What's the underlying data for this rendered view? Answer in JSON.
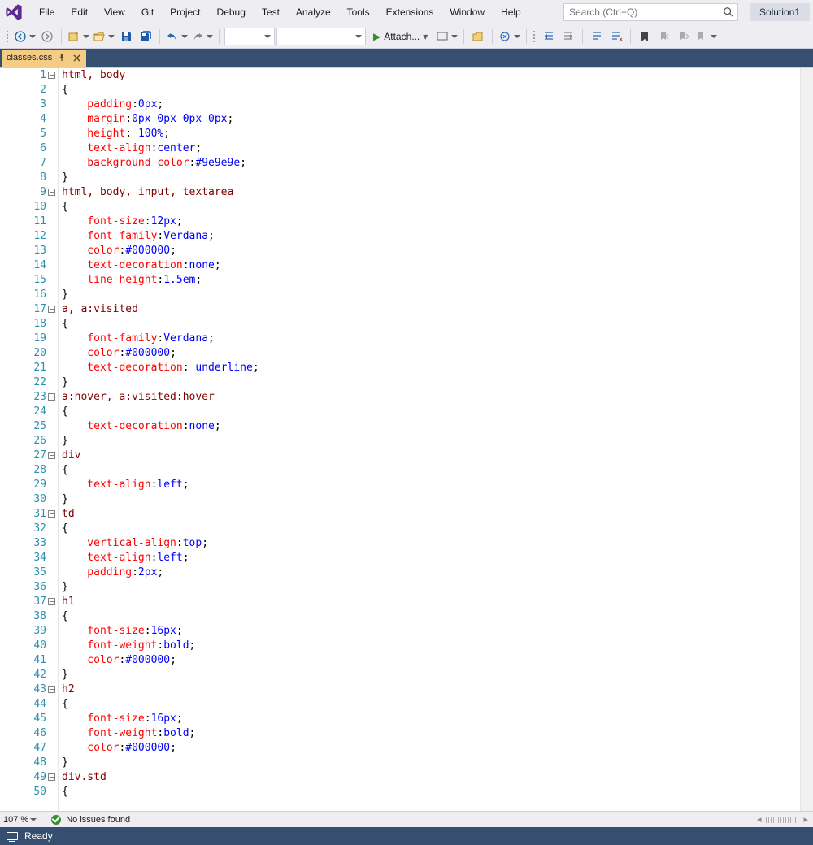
{
  "menu": [
    "File",
    "Edit",
    "View",
    "Git",
    "Project",
    "Debug",
    "Test",
    "Analyze",
    "Tools",
    "Extensions",
    "Window",
    "Help"
  ],
  "search_placeholder": "Search (Ctrl+Q)",
  "solution_name": "Solution1",
  "attach_label": "Attach...",
  "tab_title": "classes.css",
  "zoom": "107 %",
  "issues": "No issues found",
  "status": "Ready",
  "code_lines": [
    {
      "n": 1,
      "fold": true,
      "t": [
        [
          "sel",
          "html, body"
        ]
      ]
    },
    {
      "n": 2,
      "t": [
        [
          "punct",
          "{"
        ]
      ]
    },
    {
      "n": 3,
      "t": [
        [
          "prop",
          "    padding"
        ],
        [
          "punct",
          ":"
        ],
        [
          "val",
          "0px"
        ],
        [
          "punct",
          ";"
        ]
      ]
    },
    {
      "n": 4,
      "t": [
        [
          "prop",
          "    margin"
        ],
        [
          "punct",
          ":"
        ],
        [
          "val",
          "0px 0px 0px 0px"
        ],
        [
          "punct",
          ";"
        ]
      ]
    },
    {
      "n": 5,
      "t": [
        [
          "prop",
          "    height"
        ],
        [
          "punct",
          ": "
        ],
        [
          "val",
          "100%"
        ],
        [
          "punct",
          ";"
        ]
      ]
    },
    {
      "n": 6,
      "t": [
        [
          "prop",
          "    text-align"
        ],
        [
          "punct",
          ":"
        ],
        [
          "val",
          "center"
        ],
        [
          "punct",
          ";"
        ]
      ]
    },
    {
      "n": 7,
      "t": [
        [
          "prop",
          "    background-color"
        ],
        [
          "punct",
          ":"
        ],
        [
          "val",
          "#9e9e9e"
        ],
        [
          "punct",
          ";"
        ]
      ]
    },
    {
      "n": 8,
      "t": [
        [
          "punct",
          "}"
        ]
      ]
    },
    {
      "n": 9,
      "fold": true,
      "t": [
        [
          "sel",
          "html, body, input, textarea"
        ]
      ]
    },
    {
      "n": 10,
      "t": [
        [
          "punct",
          "{"
        ]
      ]
    },
    {
      "n": 11,
      "t": [
        [
          "prop",
          "    font-size"
        ],
        [
          "punct",
          ":"
        ],
        [
          "val",
          "12px"
        ],
        [
          "punct",
          ";"
        ]
      ]
    },
    {
      "n": 12,
      "t": [
        [
          "prop",
          "    font-family"
        ],
        [
          "punct",
          ":"
        ],
        [
          "val",
          "Verdana"
        ],
        [
          "punct",
          ";"
        ]
      ]
    },
    {
      "n": 13,
      "t": [
        [
          "prop",
          "    color"
        ],
        [
          "punct",
          ":"
        ],
        [
          "val",
          "#000000"
        ],
        [
          "punct",
          ";"
        ]
      ]
    },
    {
      "n": 14,
      "t": [
        [
          "prop",
          "    text-decoration"
        ],
        [
          "punct",
          ":"
        ],
        [
          "val",
          "none"
        ],
        [
          "punct",
          ";"
        ]
      ]
    },
    {
      "n": 15,
      "t": [
        [
          "prop",
          "    line-height"
        ],
        [
          "punct",
          ":"
        ],
        [
          "val",
          "1.5em"
        ],
        [
          "punct",
          ";"
        ]
      ]
    },
    {
      "n": 16,
      "t": [
        [
          "punct",
          "}"
        ]
      ]
    },
    {
      "n": 17,
      "fold": true,
      "t": [
        [
          "sel",
          "a, a:visited"
        ]
      ]
    },
    {
      "n": 18,
      "t": [
        [
          "punct",
          "{"
        ]
      ]
    },
    {
      "n": 19,
      "t": [
        [
          "prop",
          "    font-family"
        ],
        [
          "punct",
          ":"
        ],
        [
          "val",
          "Verdana"
        ],
        [
          "punct",
          ";"
        ]
      ]
    },
    {
      "n": 20,
      "t": [
        [
          "prop",
          "    color"
        ],
        [
          "punct",
          ":"
        ],
        [
          "val",
          "#000000"
        ],
        [
          "punct",
          ";"
        ]
      ]
    },
    {
      "n": 21,
      "t": [
        [
          "prop",
          "    text-decoration"
        ],
        [
          "punct",
          ": "
        ],
        [
          "val",
          "underline"
        ],
        [
          "punct",
          ";"
        ]
      ]
    },
    {
      "n": 22,
      "t": [
        [
          "punct",
          "}"
        ]
      ]
    },
    {
      "n": 23,
      "fold": true,
      "t": [
        [
          "sel",
          "a:hover, a:visited:hover"
        ]
      ]
    },
    {
      "n": 24,
      "t": [
        [
          "punct",
          "{"
        ]
      ]
    },
    {
      "n": 25,
      "t": [
        [
          "prop",
          "    text-decoration"
        ],
        [
          "punct",
          ":"
        ],
        [
          "val",
          "none"
        ],
        [
          "punct",
          ";"
        ]
      ]
    },
    {
      "n": 26,
      "t": [
        [
          "punct",
          "}"
        ]
      ]
    },
    {
      "n": 27,
      "fold": true,
      "t": [
        [
          "sel",
          "div"
        ]
      ]
    },
    {
      "n": 28,
      "t": [
        [
          "punct",
          "{"
        ]
      ]
    },
    {
      "n": 29,
      "t": [
        [
          "prop",
          "    text-align"
        ],
        [
          "punct",
          ":"
        ],
        [
          "val",
          "left"
        ],
        [
          "punct",
          ";"
        ]
      ]
    },
    {
      "n": 30,
      "t": [
        [
          "punct",
          "}"
        ]
      ]
    },
    {
      "n": 31,
      "fold": true,
      "t": [
        [
          "sel",
          "td"
        ]
      ]
    },
    {
      "n": 32,
      "t": [
        [
          "punct",
          "{"
        ]
      ]
    },
    {
      "n": 33,
      "t": [
        [
          "prop",
          "    vertical-align"
        ],
        [
          "punct",
          ":"
        ],
        [
          "val",
          "top"
        ],
        [
          "punct",
          ";"
        ]
      ]
    },
    {
      "n": 34,
      "t": [
        [
          "prop",
          "    text-align"
        ],
        [
          "punct",
          ":"
        ],
        [
          "val",
          "left"
        ],
        [
          "punct",
          ";"
        ]
      ]
    },
    {
      "n": 35,
      "t": [
        [
          "prop",
          "    padding"
        ],
        [
          "punct",
          ":"
        ],
        [
          "val",
          "2px"
        ],
        [
          "punct",
          ";"
        ]
      ]
    },
    {
      "n": 36,
      "t": [
        [
          "punct",
          "}"
        ]
      ]
    },
    {
      "n": 37,
      "fold": true,
      "t": [
        [
          "sel",
          "h1"
        ]
      ]
    },
    {
      "n": 38,
      "t": [
        [
          "punct",
          "{"
        ]
      ]
    },
    {
      "n": 39,
      "t": [
        [
          "prop",
          "    font-size"
        ],
        [
          "punct",
          ":"
        ],
        [
          "val",
          "16px"
        ],
        [
          "punct",
          ";"
        ]
      ]
    },
    {
      "n": 40,
      "t": [
        [
          "prop",
          "    font-weight"
        ],
        [
          "punct",
          ":"
        ],
        [
          "val",
          "bold"
        ],
        [
          "punct",
          ";"
        ]
      ]
    },
    {
      "n": 41,
      "t": [
        [
          "prop",
          "    color"
        ],
        [
          "punct",
          ":"
        ],
        [
          "val",
          "#000000"
        ],
        [
          "punct",
          ";"
        ]
      ]
    },
    {
      "n": 42,
      "t": [
        [
          "punct",
          "}"
        ]
      ]
    },
    {
      "n": 43,
      "fold": true,
      "t": [
        [
          "sel",
          "h2"
        ]
      ]
    },
    {
      "n": 44,
      "t": [
        [
          "punct",
          "{"
        ]
      ]
    },
    {
      "n": 45,
      "t": [
        [
          "prop",
          "    font-size"
        ],
        [
          "punct",
          ":"
        ],
        [
          "val",
          "16px"
        ],
        [
          "punct",
          ";"
        ]
      ]
    },
    {
      "n": 46,
      "t": [
        [
          "prop",
          "    font-weight"
        ],
        [
          "punct",
          ":"
        ],
        [
          "val",
          "bold"
        ],
        [
          "punct",
          ";"
        ]
      ]
    },
    {
      "n": 47,
      "t": [
        [
          "prop",
          "    color"
        ],
        [
          "punct",
          ":"
        ],
        [
          "val",
          "#000000"
        ],
        [
          "punct",
          ";"
        ]
      ]
    },
    {
      "n": 48,
      "t": [
        [
          "punct",
          "}"
        ]
      ]
    },
    {
      "n": 49,
      "fold": true,
      "t": [
        [
          "sel",
          "div.std"
        ]
      ]
    },
    {
      "n": 50,
      "t": [
        [
          "punct",
          "{"
        ]
      ]
    }
  ]
}
